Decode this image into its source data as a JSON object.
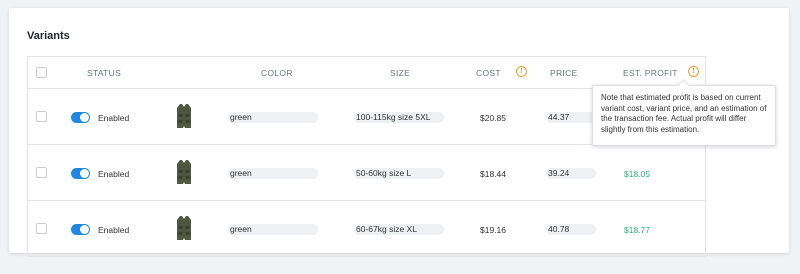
{
  "section": {
    "title": "Variants"
  },
  "table": {
    "headers": {
      "status": "STATUS",
      "color": "COLOR",
      "size": "SIZE",
      "cost": "COST",
      "price": "PRICE",
      "est_profit": "EST. PROFIT"
    },
    "info_icon_glyph": "!",
    "rows": [
      {
        "status": "Enabled",
        "enabled": true,
        "color": "green",
        "size": "100-115kg size 5XL",
        "cost": "$20.85",
        "price": "44.37",
        "profit": ""
      },
      {
        "status": "Enabled",
        "enabled": true,
        "color": "green",
        "size": "50-60kg size L",
        "cost": "$18.44",
        "price": "39.24",
        "profit": "$18.05"
      },
      {
        "status": "Enabled",
        "enabled": true,
        "color": "green",
        "size": "60-67kg size XL",
        "cost": "$19.16",
        "price": "40.78",
        "profit": "$18.77"
      }
    ]
  },
  "tooltip": {
    "text": "Note that estimated profit is based on current variant cost, variant price, and an estimation of the transaction fee. Actual profit will differ slightly from this estimation."
  },
  "colors": {
    "toggle_on": "#1e88e5",
    "profit": "#2ab27b",
    "info_icon": "#e0a33a"
  },
  "icons": {
    "product_thumbnail": "vest-icon",
    "info": "info-icon"
  }
}
